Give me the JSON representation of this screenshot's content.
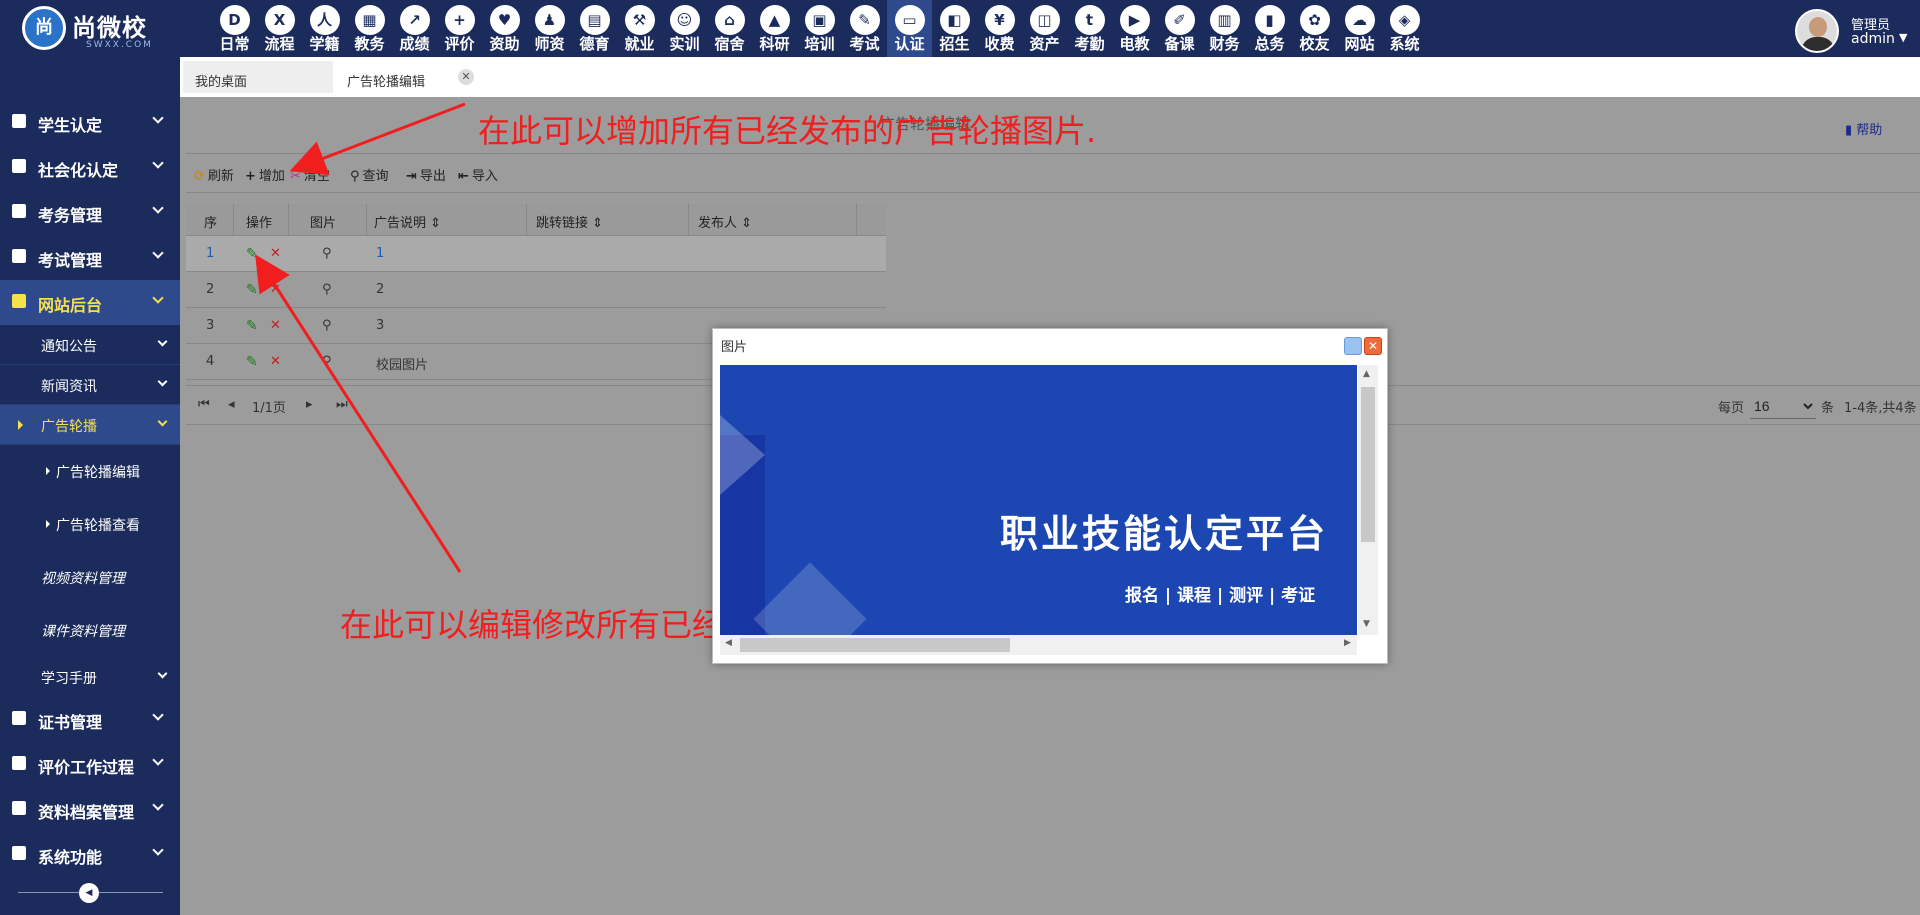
{
  "app": {
    "logo_mark": "尚",
    "logo_name": "尚微校",
    "logo_sub": "SWXX.COM"
  },
  "nav": [
    {
      "label": "日常",
      "icon": "D"
    },
    {
      "label": "流程",
      "icon": "X"
    },
    {
      "label": "学籍",
      "icon": "人"
    },
    {
      "label": "教务",
      "icon": "▦"
    },
    {
      "label": "成绩",
      "icon": "↗"
    },
    {
      "label": "评价",
      "icon": "+"
    },
    {
      "label": "资助",
      "icon": "♥"
    },
    {
      "label": "师资",
      "icon": "♟"
    },
    {
      "label": "德育",
      "icon": "▤"
    },
    {
      "label": "就业",
      "icon": "⚒"
    },
    {
      "label": "实训",
      "icon": "☺"
    },
    {
      "label": "宿舍",
      "icon": "⌂"
    },
    {
      "label": "科研",
      "icon": "▲"
    },
    {
      "label": "培训",
      "icon": "▣"
    },
    {
      "label": "考试",
      "icon": "✎"
    },
    {
      "label": "认证",
      "icon": "▭"
    },
    {
      "label": "招生",
      "icon": "◧"
    },
    {
      "label": "收费",
      "icon": "¥"
    },
    {
      "label": "资产",
      "icon": "◫"
    },
    {
      "label": "考勤",
      "icon": "t"
    },
    {
      "label": "电教",
      "icon": "▶"
    },
    {
      "label": "备课",
      "icon": "✐"
    },
    {
      "label": "财务",
      "icon": "▥"
    },
    {
      "label": "总务",
      "icon": "▮"
    },
    {
      "label": "校友",
      "icon": "✿"
    },
    {
      "label": "网站",
      "icon": "☁"
    },
    {
      "label": "系统",
      "icon": "◈"
    }
  ],
  "user": {
    "role": "管理员",
    "name": "admin",
    "caret": "▼"
  },
  "sidebar": {
    "groups_top": [
      {
        "label": "学生认定"
      },
      {
        "label": "社会化认定"
      },
      {
        "label": "考务管理"
      },
      {
        "label": "考试管理"
      }
    ],
    "active_group": {
      "label": "网站后台"
    },
    "subs": [
      {
        "label": "通知公告"
      },
      {
        "label": "新闻资讯"
      }
    ],
    "active_sub": {
      "label": "广告轮播"
    },
    "sub2": [
      {
        "label": "广告轮播编辑"
      },
      {
        "label": "广告轮播查看"
      }
    ],
    "italic_items": [
      {
        "label": "视频资料管理"
      },
      {
        "label": "课件资料管理"
      }
    ],
    "manual": {
      "label": "学习手册"
    },
    "groups_bottom": [
      {
        "label": "证书管理"
      },
      {
        "label": "评价工作过程"
      },
      {
        "label": "资料档案管理"
      },
      {
        "label": "系统功能"
      }
    ],
    "toggle_icon": "◀"
  },
  "tabs": [
    {
      "label": "我的桌面"
    },
    {
      "label": "广告轮播编辑",
      "close": "✕"
    }
  ],
  "crumb": "广告轮播编辑",
  "help": "帮助",
  "toolbar": {
    "refresh": "刷新",
    "add": "增加",
    "clear": "清空",
    "search": "查询",
    "export": "导出",
    "import": "导入"
  },
  "grid": {
    "headers": [
      "序",
      "操作",
      "图片",
      "广告说明",
      "跳转链接",
      "发布人"
    ],
    "rows": [
      {
        "no": "1",
        "desc": "1"
      },
      {
        "no": "2",
        "desc": "2"
      },
      {
        "no": "3",
        "desc": "3"
      },
      {
        "no": "4",
        "desc": "校园图片"
      }
    ]
  },
  "pager": {
    "page": "1/1页",
    "per_label": "每页",
    "per_value": "16",
    "unit": "条",
    "summary": "1-4条,共4条"
  },
  "annotations": {
    "top": "在此可以增加所有已经发布的广告轮播图片.",
    "bottom": "在此可以编辑修改所有已经发布的广告轮播图片."
  },
  "dialog": {
    "title": "图片",
    "close": "✕",
    "banner_title": "职业技能认定平台",
    "banner_sub": "报名 | 课程 | 测评 | 考证"
  },
  "colors": {
    "navbar": "#1b2b5c",
    "active": "#2e4a8c",
    "highlight": "#f5e14a",
    "annotation": "#f01e1e",
    "banner": "#1c47b3"
  }
}
